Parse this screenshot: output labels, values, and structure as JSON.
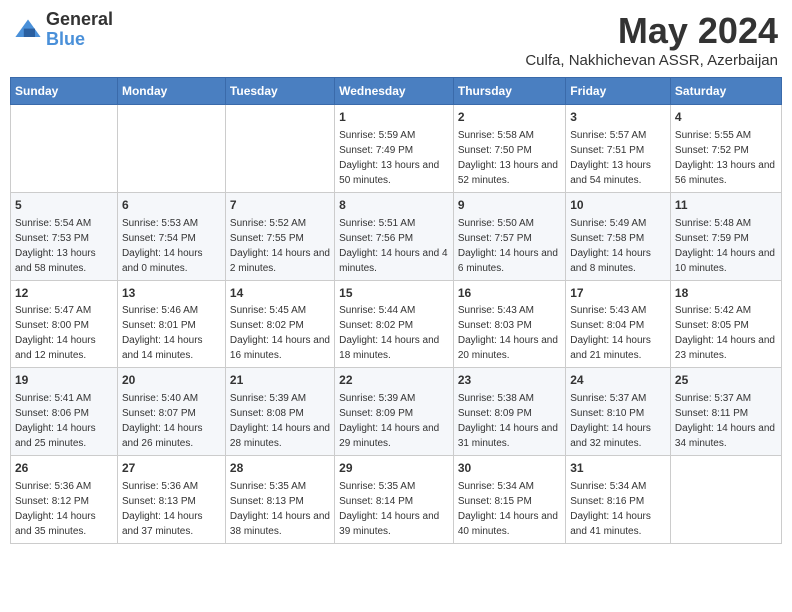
{
  "logo": {
    "line1": "General",
    "line2": "Blue"
  },
  "title": "May 2024",
  "subtitle": "Culfa, Nakhichevan ASSR, Azerbaijan",
  "weekdays": [
    "Sunday",
    "Monday",
    "Tuesday",
    "Wednesday",
    "Thursday",
    "Friday",
    "Saturday"
  ],
  "weeks": [
    [
      null,
      null,
      null,
      {
        "day": "1",
        "sunrise": "Sunrise: 5:59 AM",
        "sunset": "Sunset: 7:49 PM",
        "daylight": "Daylight: 13 hours and 50 minutes."
      },
      {
        "day": "2",
        "sunrise": "Sunrise: 5:58 AM",
        "sunset": "Sunset: 7:50 PM",
        "daylight": "Daylight: 13 hours and 52 minutes."
      },
      {
        "day": "3",
        "sunrise": "Sunrise: 5:57 AM",
        "sunset": "Sunset: 7:51 PM",
        "daylight": "Daylight: 13 hours and 54 minutes."
      },
      {
        "day": "4",
        "sunrise": "Sunrise: 5:55 AM",
        "sunset": "Sunset: 7:52 PM",
        "daylight": "Daylight: 13 hours and 56 minutes."
      }
    ],
    [
      {
        "day": "5",
        "sunrise": "Sunrise: 5:54 AM",
        "sunset": "Sunset: 7:53 PM",
        "daylight": "Daylight: 13 hours and 58 minutes."
      },
      {
        "day": "6",
        "sunrise": "Sunrise: 5:53 AM",
        "sunset": "Sunset: 7:54 PM",
        "daylight": "Daylight: 14 hours and 0 minutes."
      },
      {
        "day": "7",
        "sunrise": "Sunrise: 5:52 AM",
        "sunset": "Sunset: 7:55 PM",
        "daylight": "Daylight: 14 hours and 2 minutes."
      },
      {
        "day": "8",
        "sunrise": "Sunrise: 5:51 AM",
        "sunset": "Sunset: 7:56 PM",
        "daylight": "Daylight: 14 hours and 4 minutes."
      },
      {
        "day": "9",
        "sunrise": "Sunrise: 5:50 AM",
        "sunset": "Sunset: 7:57 PM",
        "daylight": "Daylight: 14 hours and 6 minutes."
      },
      {
        "day": "10",
        "sunrise": "Sunrise: 5:49 AM",
        "sunset": "Sunset: 7:58 PM",
        "daylight": "Daylight: 14 hours and 8 minutes."
      },
      {
        "day": "11",
        "sunrise": "Sunrise: 5:48 AM",
        "sunset": "Sunset: 7:59 PM",
        "daylight": "Daylight: 14 hours and 10 minutes."
      }
    ],
    [
      {
        "day": "12",
        "sunrise": "Sunrise: 5:47 AM",
        "sunset": "Sunset: 8:00 PM",
        "daylight": "Daylight: 14 hours and 12 minutes."
      },
      {
        "day": "13",
        "sunrise": "Sunrise: 5:46 AM",
        "sunset": "Sunset: 8:01 PM",
        "daylight": "Daylight: 14 hours and 14 minutes."
      },
      {
        "day": "14",
        "sunrise": "Sunrise: 5:45 AM",
        "sunset": "Sunset: 8:02 PM",
        "daylight": "Daylight: 14 hours and 16 minutes."
      },
      {
        "day": "15",
        "sunrise": "Sunrise: 5:44 AM",
        "sunset": "Sunset: 8:02 PM",
        "daylight": "Daylight: 14 hours and 18 minutes."
      },
      {
        "day": "16",
        "sunrise": "Sunrise: 5:43 AM",
        "sunset": "Sunset: 8:03 PM",
        "daylight": "Daylight: 14 hours and 20 minutes."
      },
      {
        "day": "17",
        "sunrise": "Sunrise: 5:43 AM",
        "sunset": "Sunset: 8:04 PM",
        "daylight": "Daylight: 14 hours and 21 minutes."
      },
      {
        "day": "18",
        "sunrise": "Sunrise: 5:42 AM",
        "sunset": "Sunset: 8:05 PM",
        "daylight": "Daylight: 14 hours and 23 minutes."
      }
    ],
    [
      {
        "day": "19",
        "sunrise": "Sunrise: 5:41 AM",
        "sunset": "Sunset: 8:06 PM",
        "daylight": "Daylight: 14 hours and 25 minutes."
      },
      {
        "day": "20",
        "sunrise": "Sunrise: 5:40 AM",
        "sunset": "Sunset: 8:07 PM",
        "daylight": "Daylight: 14 hours and 26 minutes."
      },
      {
        "day": "21",
        "sunrise": "Sunrise: 5:39 AM",
        "sunset": "Sunset: 8:08 PM",
        "daylight": "Daylight: 14 hours and 28 minutes."
      },
      {
        "day": "22",
        "sunrise": "Sunrise: 5:39 AM",
        "sunset": "Sunset: 8:09 PM",
        "daylight": "Daylight: 14 hours and 29 minutes."
      },
      {
        "day": "23",
        "sunrise": "Sunrise: 5:38 AM",
        "sunset": "Sunset: 8:09 PM",
        "daylight": "Daylight: 14 hours and 31 minutes."
      },
      {
        "day": "24",
        "sunrise": "Sunrise: 5:37 AM",
        "sunset": "Sunset: 8:10 PM",
        "daylight": "Daylight: 14 hours and 32 minutes."
      },
      {
        "day": "25",
        "sunrise": "Sunrise: 5:37 AM",
        "sunset": "Sunset: 8:11 PM",
        "daylight": "Daylight: 14 hours and 34 minutes."
      }
    ],
    [
      {
        "day": "26",
        "sunrise": "Sunrise: 5:36 AM",
        "sunset": "Sunset: 8:12 PM",
        "daylight": "Daylight: 14 hours and 35 minutes."
      },
      {
        "day": "27",
        "sunrise": "Sunrise: 5:36 AM",
        "sunset": "Sunset: 8:13 PM",
        "daylight": "Daylight: 14 hours and 37 minutes."
      },
      {
        "day": "28",
        "sunrise": "Sunrise: 5:35 AM",
        "sunset": "Sunset: 8:13 PM",
        "daylight": "Daylight: 14 hours and 38 minutes."
      },
      {
        "day": "29",
        "sunrise": "Sunrise: 5:35 AM",
        "sunset": "Sunset: 8:14 PM",
        "daylight": "Daylight: 14 hours and 39 minutes."
      },
      {
        "day": "30",
        "sunrise": "Sunrise: 5:34 AM",
        "sunset": "Sunset: 8:15 PM",
        "daylight": "Daylight: 14 hours and 40 minutes."
      },
      {
        "day": "31",
        "sunrise": "Sunrise: 5:34 AM",
        "sunset": "Sunset: 8:16 PM",
        "daylight": "Daylight: 14 hours and 41 minutes."
      },
      null
    ]
  ]
}
